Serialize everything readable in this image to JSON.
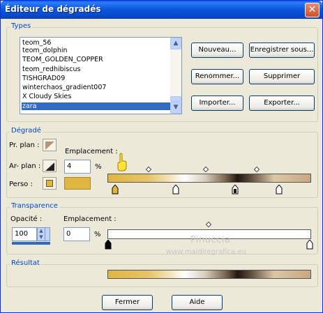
{
  "window": {
    "title": "Éditeur de dégradés",
    "close_glyph": "✕"
  },
  "types": {
    "group_title": "Types",
    "list": [
      "teom_56",
      "teom_dolphin",
      "TEOM_GOLDEN_COPPER",
      "teom_redhibiscus",
      "TISHGRAD09",
      "winterchaos_gradient007",
      "X Cloudy Skies",
      "zara"
    ],
    "selected_index": 7,
    "buttons": {
      "new": "Nouveau...",
      "save_as": "Enregistrer sous...",
      "rename": "Renommer...",
      "delete": "Supprimer",
      "import": "Importer...",
      "export": "Exporter..."
    }
  },
  "gradient": {
    "group_title": "Dégradé",
    "foreground_label": "Pr. plan :",
    "background_label": "Ar- plan :",
    "custom_label": "Perso :",
    "location_label": "Emplacement :",
    "location_value": "4",
    "percent": "%",
    "custom_color": "#e0b640",
    "colors": [
      "#e0b640",
      "#f3e2b6",
      "#ffffff",
      "#7b6550",
      "#231611",
      "#dcc7a5",
      "#c9a782"
    ]
  },
  "transparency": {
    "group_title": "Transparence",
    "opacity_label": "Opacité :",
    "opacity_value": "100",
    "location_label": "Emplacement :",
    "location_value": "0",
    "percent": "%"
  },
  "result": {
    "group_title": "Résultat"
  },
  "footer": {
    "close": "Fermer",
    "help": "Aide"
  },
  "watermark": {
    "name": "Pinuccia",
    "url": "www.maidiregrafica.eu"
  },
  "icons": {
    "scroll_up": "▲",
    "scroll_down": "▼",
    "spin_up": "▲",
    "spin_down": "▼"
  }
}
